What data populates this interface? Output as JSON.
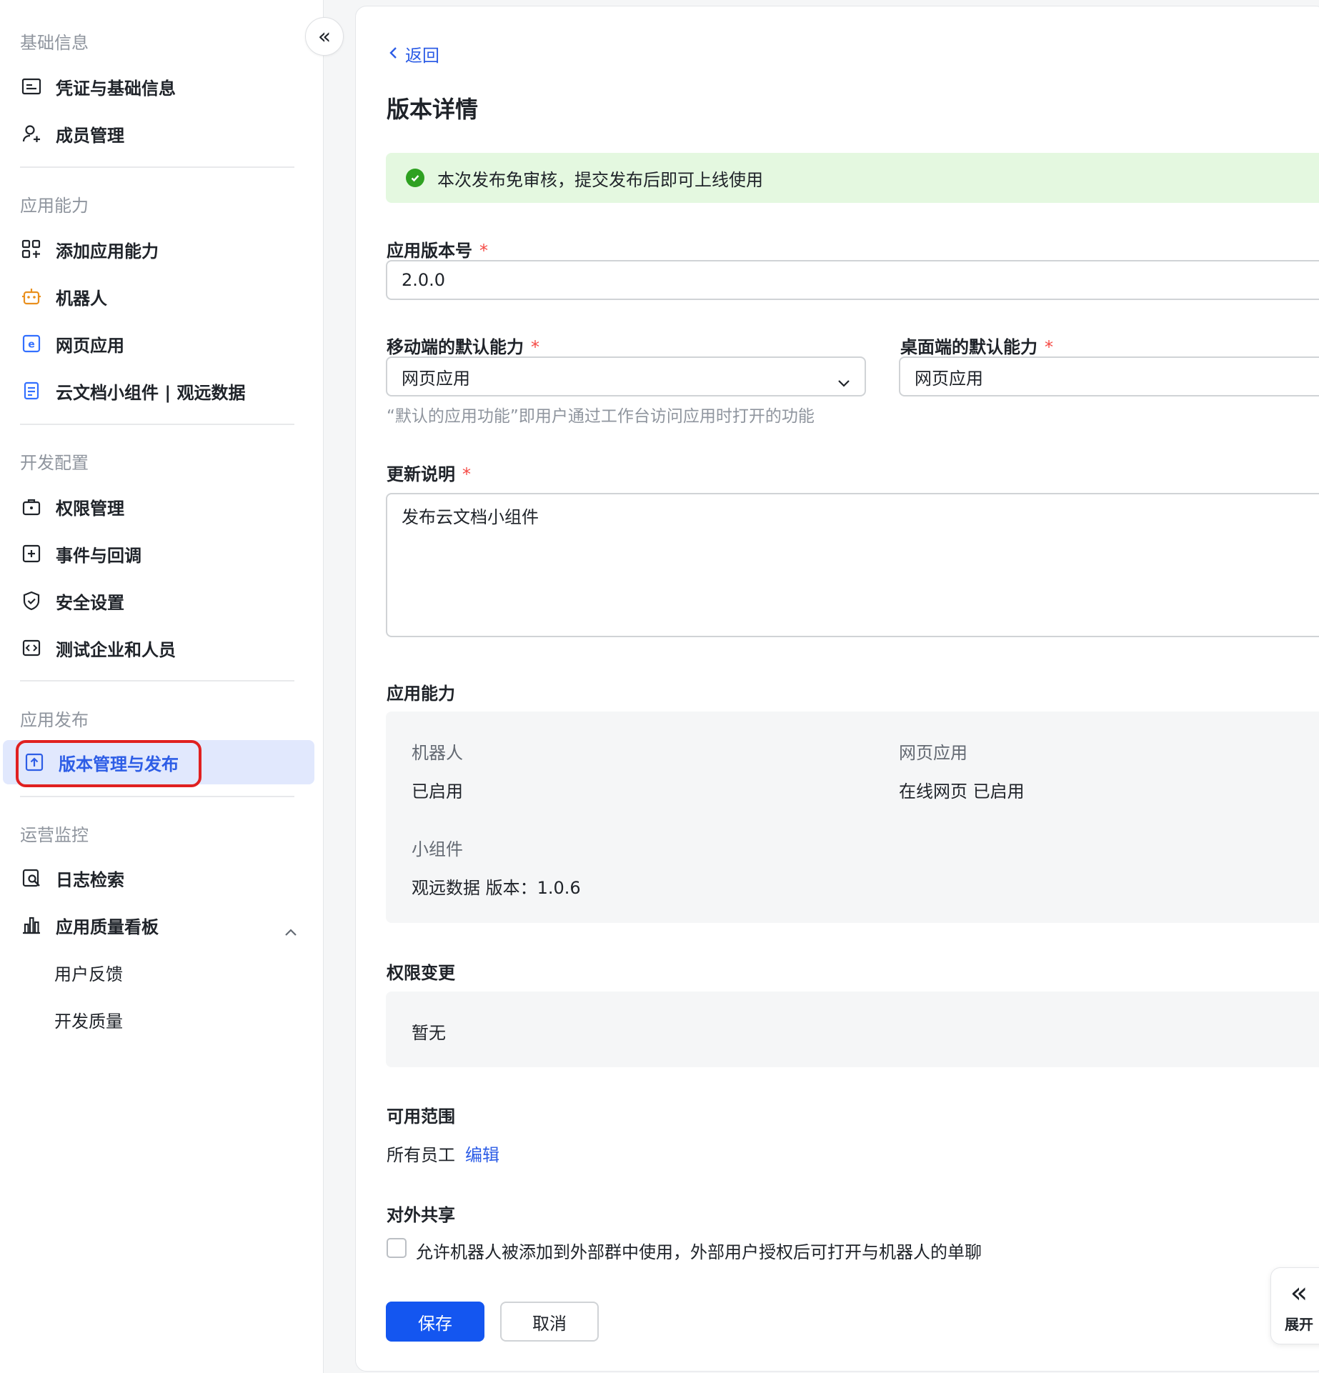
{
  "sidebar": {
    "collapse_icon": "«",
    "sections": {
      "basic": "基础信息",
      "capability": "应用能力",
      "dev": "开发配置",
      "release": "应用发布",
      "ops": "运营监控"
    },
    "items": {
      "credentials": "凭证与基础信息",
      "members": "成员管理",
      "add_capability": "添加应用能力",
      "bot": "机器人",
      "web_app": "网页应用",
      "doc_widget": "云文档小组件 | 观远数据",
      "permissions": "权限管理",
      "events": "事件与回调",
      "security": "安全设置",
      "test_org": "测试企业和人员",
      "version_release": "版本管理与发布",
      "log_search": "日志检索",
      "quality_board": "应用质量看板",
      "user_feedback": "用户反馈",
      "dev_quality": "开发质量"
    }
  },
  "main": {
    "back": "返回",
    "title": "版本详情",
    "notice": "本次发布免审核，提交发布后即可上线使用",
    "version_label": "应用版本号",
    "version_value": "2.0.0",
    "mobile_label": "移动端的默认能力",
    "mobile_value": "网页应用",
    "desktop_label": "桌面端的默认能力",
    "desktop_value": "网页应用",
    "default_hint": "“默认的应用功能”即用户通过工作台访问应用时打开的功能",
    "notes_label": "更新说明",
    "notes_value": "发布云文档小组件",
    "required_mark": "*",
    "capabilities_heading": "应用能力",
    "capabilities": {
      "bot_label": "机器人",
      "bot_value": "已启用",
      "web_label": "网页应用",
      "web_value": "在线网页 已启用",
      "widget_label": "小组件",
      "widget_value": "观远数据 版本：1.0.6"
    },
    "permission_heading": "权限变更",
    "permission_value": "暂无",
    "scope_heading": "可用范围",
    "scope_value": "所有员工",
    "scope_edit": "编辑",
    "share_heading": "对外共享",
    "share_checkbox_label": "允许机器人被添加到外部群中使用，外部用户授权后可打开与机器人的单聊",
    "share_checked": false,
    "save": "保存",
    "cancel": "取消",
    "expand_icon": "«",
    "expand_label": "展开"
  },
  "colors": {
    "accent": "#1456f0",
    "link": "#2d5de6",
    "active_bg": "#e1e8fd",
    "success": "#2ea121",
    "notice_bg": "#e4f8e0",
    "required": "#f54a45",
    "highlight_ring": "#e02020"
  }
}
